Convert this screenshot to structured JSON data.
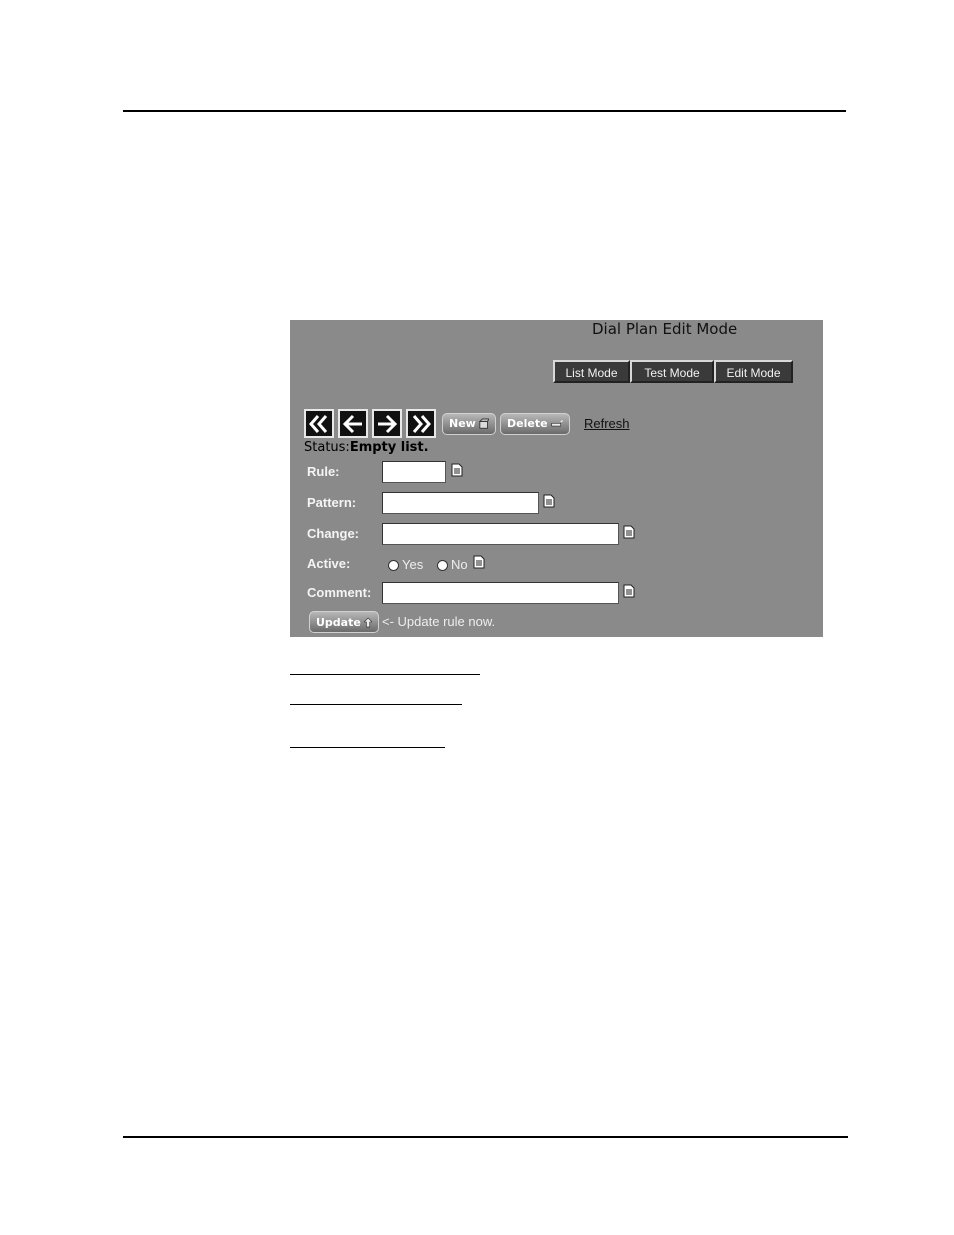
{
  "panel": {
    "title": "Dial Plan Edit Mode",
    "mode_tabs": [
      "List Mode",
      "Test Mode",
      "Edit Mode"
    ],
    "nav_icons": [
      "first-icon",
      "previous-icon",
      "next-icon",
      "last-icon"
    ],
    "new_label": "New",
    "delete_label": "Delete",
    "refresh_label": "Refresh",
    "status_label": "Status:",
    "status_value": "Empty list.",
    "fields": {
      "rule_label": "Rule:",
      "pattern_label": "Pattern:",
      "change_label": "Change:",
      "active_label": "Active:",
      "comment_label": "Comment:",
      "yes_label": "Yes",
      "no_label": "No"
    },
    "update_label": "Update",
    "update_hint": "<- Update rule now."
  },
  "colors": {
    "panel_bg": "#8a8a8a",
    "tab_bg": "#3a3a3a"
  }
}
